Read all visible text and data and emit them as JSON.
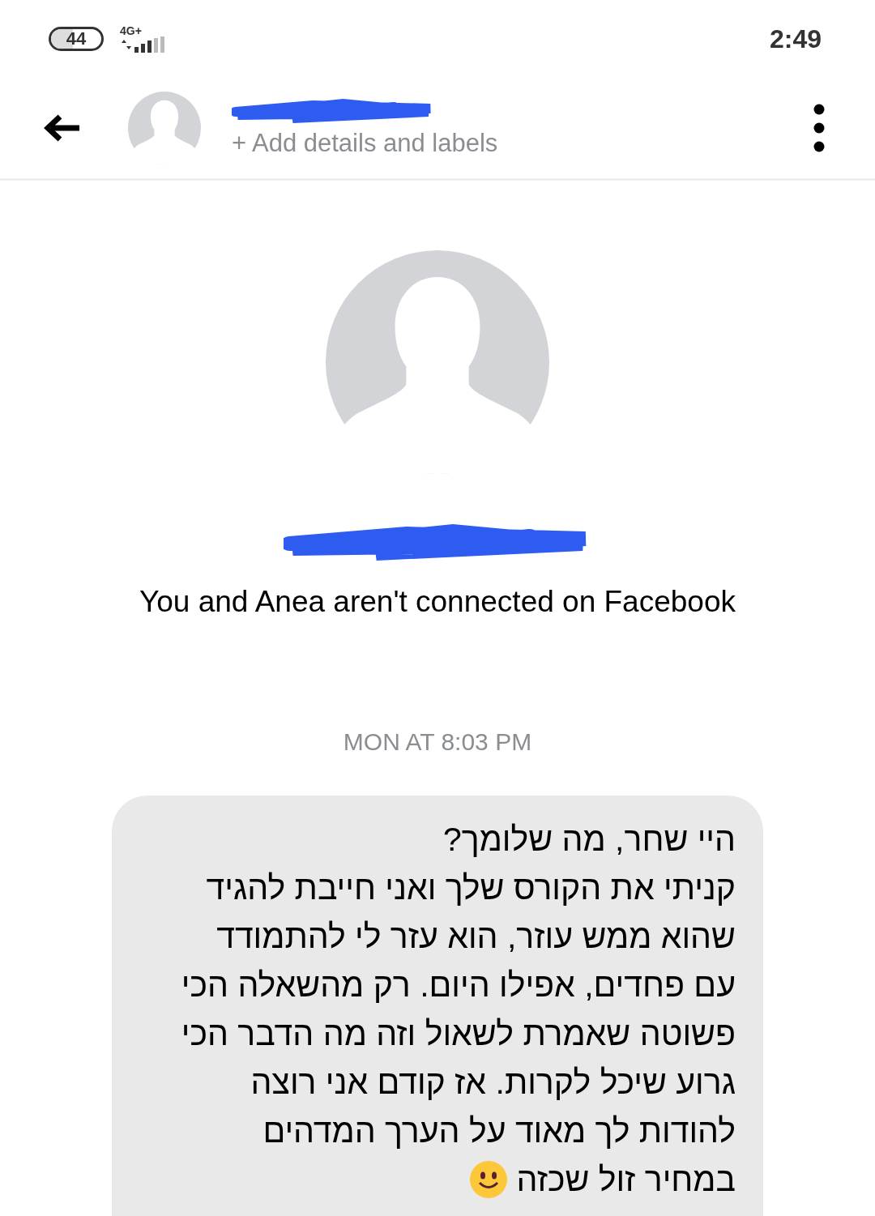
{
  "status_bar": {
    "battery": "44",
    "network": "4G+",
    "time": "2:49"
  },
  "header": {
    "subtitle": "+ Add details and labels"
  },
  "profile": {
    "connection_note": "You and Anea aren't connected on Facebook"
  },
  "timestamp": "MON AT 8:03 PM",
  "message": {
    "lines": [
      "היי שחר, מה שלומך?",
      "קניתי את הקורס שלך ואני חייבת להגיד",
      "שהוא ממש עוזר, הוא עזר לי להתמודד",
      "עם פחדים, אפילו היום. רק מהשאלה הכי",
      "פשוטה שאמרת לשאול וזה מה הדבר הכי",
      "גרוע שיכל לקרות. אז קודם אני רוצה",
      "להודות לך מאוד על הערך המדהים",
      "במחיר זול שכזה"
    ],
    "ends_with_emoji": true
  }
}
